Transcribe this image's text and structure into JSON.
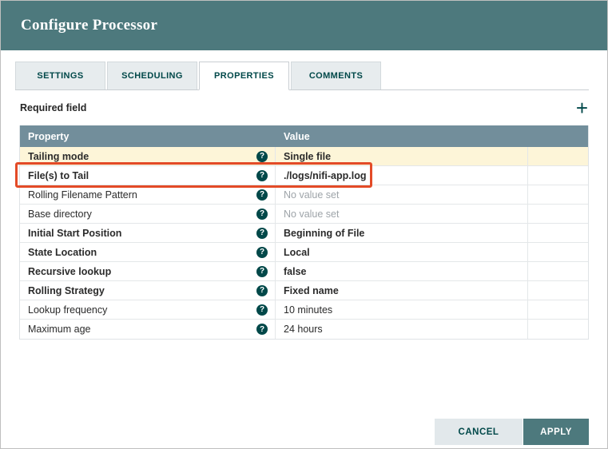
{
  "dialog": {
    "title": "Configure Processor"
  },
  "tabs": [
    {
      "label": "SETTINGS",
      "active": false
    },
    {
      "label": "SCHEDULING",
      "active": false
    },
    {
      "label": "PROPERTIES",
      "active": true
    },
    {
      "label": "COMMENTS",
      "active": false
    }
  ],
  "labels": {
    "required_field": "Required field"
  },
  "icons": {
    "add_glyph": "+",
    "help_glyph": "?"
  },
  "table": {
    "columns": [
      "Property",
      "Value"
    ],
    "rows": [
      {
        "property": "Tailing mode",
        "value": "Single file",
        "bold": true,
        "highlighted": true,
        "annotated": false
      },
      {
        "property": "File(s) to Tail",
        "value": "./logs/nifi-app.log",
        "bold": true,
        "highlighted": false,
        "annotated": true
      },
      {
        "property": "Rolling Filename Pattern",
        "value": "No value set",
        "bold": false,
        "unset": true
      },
      {
        "property": "Base directory",
        "value": "No value set",
        "bold": false,
        "unset": true
      },
      {
        "property": "Initial Start Position",
        "value": "Beginning of File",
        "bold": true
      },
      {
        "property": "State Location",
        "value": "Local",
        "bold": true
      },
      {
        "property": "Recursive lookup",
        "value": "false",
        "bold": true
      },
      {
        "property": "Rolling Strategy",
        "value": "Fixed name",
        "bold": true
      },
      {
        "property": "Lookup frequency",
        "value": "10 minutes",
        "bold": false
      },
      {
        "property": "Maximum age",
        "value": "24 hours",
        "bold": false
      }
    ]
  },
  "buttons": {
    "cancel": "CANCEL",
    "apply": "APPLY"
  },
  "colors": {
    "header_teal": "#4d797d",
    "table_header_slate": "#728e9b",
    "highlight_yellow": "#fdf5d8",
    "annotation_red": "#e34b27",
    "accent_dark_teal": "#004849"
  }
}
